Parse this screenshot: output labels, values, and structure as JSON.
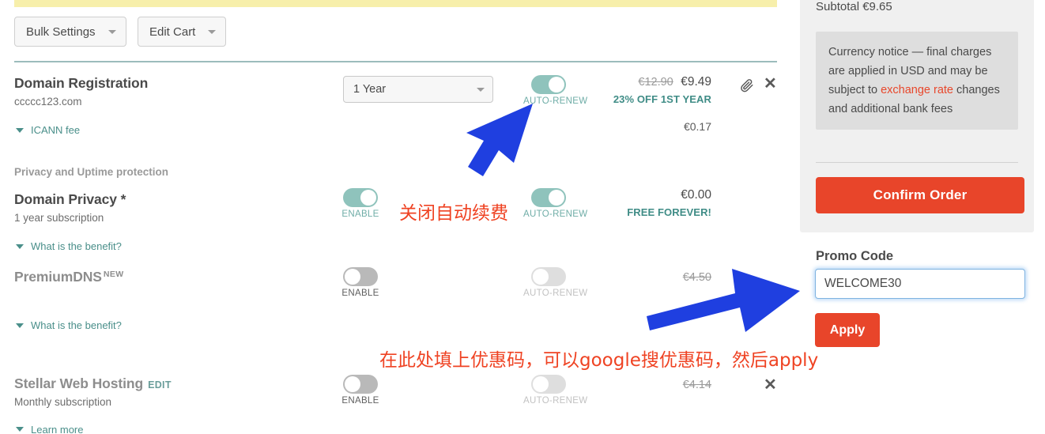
{
  "toolbar": {
    "bulk_settings": "Bulk Settings",
    "edit_cart": "Edit Cart"
  },
  "rows": [
    {
      "name": "Domain Registration",
      "sub": "ccccc123.com",
      "disclose": "ICANN fee",
      "term": "1 Year",
      "auto_renew_label": "AUTO-RENEW",
      "auto_renew_state": "on",
      "price_old": "€12.90",
      "price_new": "€9.49",
      "promo_text": "23% OFF 1ST YEAR",
      "secondary_price": "€0.17",
      "attach_icon": "paperclip-icon",
      "remove_icon": "close-icon"
    },
    {
      "section_label": "Privacy and Uptime protection",
      "name": "Domain Privacy *",
      "sub": "1 year subscription",
      "disclose": "What is the benefit?",
      "enable_label": "ENABLE",
      "enable_state": "on",
      "auto_renew_label": "AUTO-RENEW",
      "auto_renew_state": "on",
      "price_new": "€0.00",
      "promo_text": "FREE FOREVER!"
    },
    {
      "name": "PremiumDNS",
      "badge": "NEW",
      "disclose": "What is the benefit?",
      "enable_label": "ENABLE",
      "enable_state": "off",
      "auto_renew_label": "AUTO-RENEW",
      "auto_renew_state": "off",
      "price_strike": "€4.50"
    },
    {
      "name": "Stellar Web Hosting",
      "edit": "EDIT",
      "sub": "Monthly subscription",
      "enable_label": "ENABLE",
      "enable_state": "off",
      "auto_renew_label": "AUTO-RENEW",
      "auto_renew_state": "off",
      "price_strike": "€4.14",
      "remove_icon": "close-icon"
    }
  ],
  "sidebar": {
    "subtotal": "Subtotal €9.65",
    "notice_before": "Currency notice — final charges are applied in USD and may be subject to ",
    "notice_highlight": "exchange rate",
    "notice_after": " changes and additional bank fees",
    "confirm_label": "Confirm Order",
    "promo_title": "Promo Code",
    "promo_value": "WELCOME30",
    "apply_label": "Apply"
  },
  "annotations": {
    "auto_renew_note": "关闭自动续费",
    "promo_note": "在此处填上优惠码，可以google搜优惠码，然后apply"
  },
  "colors": {
    "accent_red": "#e8452a",
    "teal": "#8fc3bc",
    "annotation_red": "#ef4323",
    "arrow_blue": "#1f3fe0"
  }
}
